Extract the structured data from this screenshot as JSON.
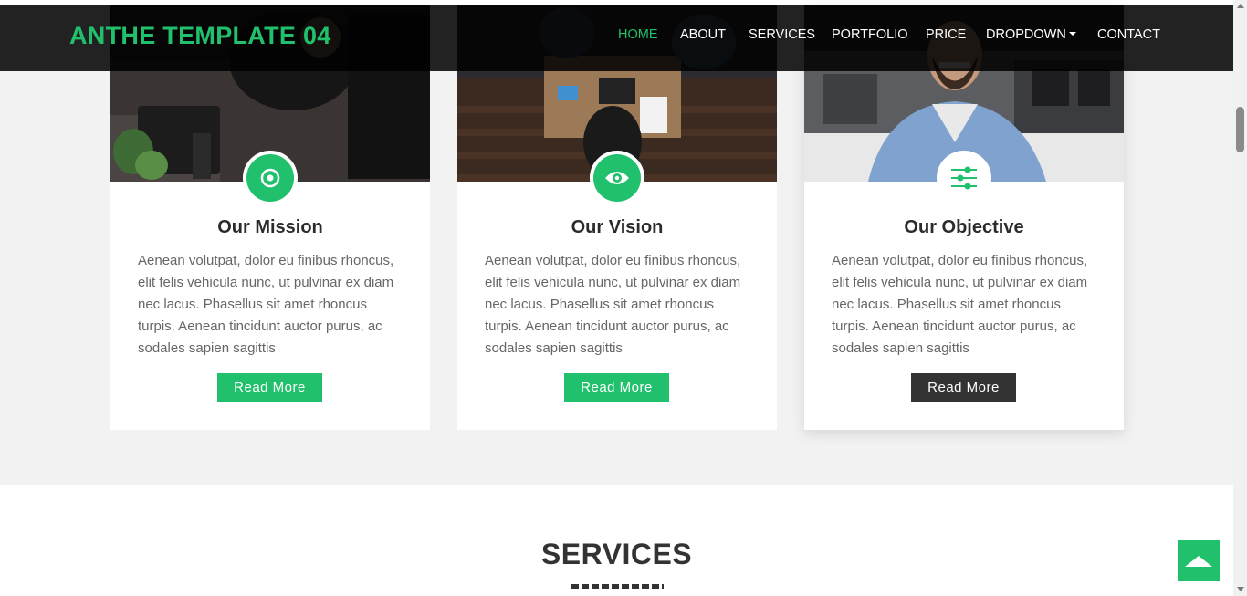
{
  "navbar": {
    "brand": "ANTHE TEMPLATE 04",
    "items": [
      {
        "label": "HOME",
        "active": true
      },
      {
        "label": "ABOUT"
      },
      {
        "label": "SERVICES"
      },
      {
        "label": "PORTFOLIO"
      },
      {
        "label": "PRICE"
      },
      {
        "label": "DROPDOWN",
        "has_caret": true
      },
      {
        "label": "CONTACT"
      }
    ]
  },
  "cards": [
    {
      "title": "Our Mission",
      "icon": "target-icon",
      "text": "Aenean volutpat, dolor eu finibus rhoncus, elit felis vehicula nunc, ut pulvinar ex diam nec lacus. Phasellus sit amet rhoncus turpis. Aenean tincidunt auctor purus, ac sodales sapien sagittis",
      "button": "Read More"
    },
    {
      "title": "Our Vision",
      "icon": "eye-icon",
      "text": "Aenean volutpat, dolor eu finibus rhoncus, elit felis vehicula nunc, ut pulvinar ex diam nec lacus. Phasellus sit amet rhoncus turpis. Aenean tincidunt auctor purus, ac sodales sapien sagittis",
      "button": "Read More"
    },
    {
      "title": "Our Objective",
      "icon": "sliders-icon",
      "text": "Aenean volutpat, dolor eu finibus rhoncus, elit felis vehicula nunc, ut pulvinar ex diam nec lacus. Phasellus sit amet rhoncus turpis. Aenean tincidunt auctor purus, ac sodales sapien sagittis",
      "button": "Read More"
    }
  ],
  "services": {
    "heading": "SERVICES"
  },
  "scroll_top": {
    "icon": "arrow-up-icon"
  },
  "colors": {
    "accent": "#20c06c",
    "dark_button": "#333333",
    "navbar_bg": "#000000",
    "section_bg": "#f2f2f2"
  }
}
